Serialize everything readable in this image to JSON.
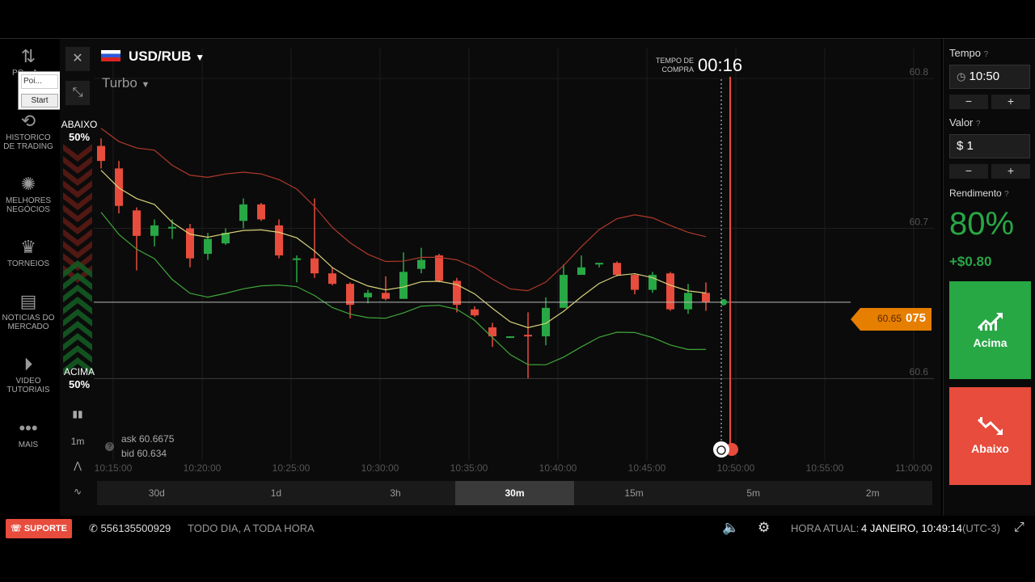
{
  "nav": {
    "items": [
      {
        "label": "PO... A...",
        "icon": "swap-arrows-icon"
      },
      {
        "label": "HISTORICO DE TRADING",
        "icon": "history-icon"
      },
      {
        "label": "MELHORES NEGÓCIOS",
        "icon": "best-deals-icon"
      },
      {
        "label": "TORNEIOS",
        "icon": "trophy-icon"
      },
      {
        "label": "NOTICIAS DO MERCADO",
        "icon": "news-icon"
      },
      {
        "label": "VIDEO TUTORIAIS",
        "icon": "play-icon"
      },
      {
        "label": "MAIS",
        "icon": "more-dots-icon"
      }
    ]
  },
  "popup": {
    "input_value": "Poi...",
    "button_label": "Start"
  },
  "asset": {
    "name": "USD/RUB",
    "mode": "Turbo"
  },
  "timer": {
    "label": "TEMPO DE COMPRA",
    "value": "00:16"
  },
  "sentiment": {
    "down_label": "ABAIXO",
    "down_pct": "50%",
    "up_label": "ACIMA",
    "up_pct": "50%"
  },
  "quote": {
    "ask": "ask 60.6675",
    "bid": "bid 60.634",
    "timeframe": "1m"
  },
  "current_price": {
    "prefix": "60.65",
    "suffix": "075"
  },
  "chart_data": {
    "type": "candlestick",
    "y_ticks": [
      "60.8",
      "60.7",
      "60.6"
    ],
    "x_ticks": [
      "10:15:00",
      "10:20:00",
      "10:25:00",
      "10:30:00",
      "10:35:00",
      "10:40:00",
      "10:45:00",
      "10:50:00",
      "10:55:00",
      "11:00:00"
    ],
    "ylim": [
      60.545,
      60.82
    ],
    "candles": [
      {
        "o": 60.755,
        "c": 60.745,
        "h": 60.76,
        "l": 60.74
      },
      {
        "o": 60.74,
        "c": 60.715,
        "h": 60.745,
        "l": 60.71
      },
      {
        "o": 60.712,
        "c": 60.695,
        "h": 60.714,
        "l": 60.672
      },
      {
        "o": 60.695,
        "c": 60.702,
        "h": 60.706,
        "l": 60.688
      },
      {
        "o": 60.7,
        "c": 60.701,
        "h": 60.706,
        "l": 60.693
      },
      {
        "o": 60.7,
        "c": 60.68,
        "h": 60.703,
        "l": 60.674
      },
      {
        "o": 60.683,
        "c": 60.693,
        "h": 60.697,
        "l": 60.679
      },
      {
        "o": 60.69,
        "c": 60.697,
        "h": 60.7,
        "l": 60.689
      },
      {
        "o": 60.705,
        "c": 60.716,
        "h": 60.72,
        "l": 60.7
      },
      {
        "o": 60.716,
        "c": 60.706,
        "h": 60.717,
        "l": 60.705
      },
      {
        "o": 60.702,
        "c": 60.682,
        "h": 60.706,
        "l": 60.68
      },
      {
        "o": 60.68,
        "c": 60.68,
        "h": 60.682,
        "l": 60.664
      },
      {
        "o": 60.68,
        "c": 60.67,
        "h": 60.72,
        "l": 60.667
      },
      {
        "o": 60.67,
        "c": 60.663,
        "h": 60.674,
        "l": 60.662
      },
      {
        "o": 60.663,
        "c": 60.649,
        "h": 60.664,
        "l": 60.64
      },
      {
        "o": 60.654,
        "c": 60.657,
        "h": 60.659,
        "l": 60.65
      },
      {
        "o": 60.657,
        "c": 60.653,
        "h": 60.668,
        "l": 60.652
      },
      {
        "o": 60.653,
        "c": 60.671,
        "h": 60.684,
        "l": 60.653
      },
      {
        "o": 60.673,
        "c": 60.679,
        "h": 60.687,
        "l": 60.67
      },
      {
        "o": 60.682,
        "c": 60.665,
        "h": 60.683,
        "l": 60.664
      },
      {
        "o": 60.665,
        "c": 60.649,
        "h": 60.667,
        "l": 60.644
      },
      {
        "o": 60.646,
        "c": 60.642,
        "h": 60.648,
        "l": 60.641
      },
      {
        "o": 60.634,
        "c": 60.628,
        "h": 60.637,
        "l": 60.621
      },
      {
        "o": 60.628,
        "c": 60.628,
        "h": 60.628,
        "l": 60.627
      },
      {
        "o": 60.629,
        "c": 60.628,
        "h": 60.644,
        "l": 60.6
      },
      {
        "o": 60.628,
        "c": 60.647,
        "h": 60.654,
        "l": 60.622
      },
      {
        "o": 60.647,
        "c": 60.669,
        "h": 60.676,
        "l": 60.647
      },
      {
        "o": 60.669,
        "c": 60.674,
        "h": 60.682,
        "l": 60.669
      },
      {
        "o": 60.676,
        "c": 60.677,
        "h": 60.677,
        "l": 60.674
      },
      {
        "o": 60.677,
        "c": 60.669,
        "h": 60.678,
        "l": 60.668
      },
      {
        "o": 60.669,
        "c": 60.659,
        "h": 60.67,
        "l": 60.656
      },
      {
        "o": 60.659,
        "c": 60.669,
        "h": 60.671,
        "l": 60.657
      },
      {
        "o": 60.67,
        "c": 60.646,
        "h": 60.671,
        "l": 60.645
      },
      {
        "o": 60.646,
        "c": 60.657,
        "h": 60.663,
        "l": 60.643
      },
      {
        "o": 60.657,
        "c": 60.651,
        "h": 60.664,
        "l": 60.645
      }
    ],
    "up_color": "#28a745",
    "down_color": "#e74c3c",
    "band_colors": {
      "upper": "#b0392b",
      "middle": "#d8d27a",
      "lower": "#3fa63a"
    }
  },
  "ranges": {
    "items": [
      "30d",
      "1d",
      "3h",
      "30m",
      "15m",
      "5m",
      "2m"
    ],
    "active": "30m"
  },
  "trade": {
    "time_label": "Tempo",
    "time_value": "10:50",
    "value_label": "Valor",
    "value_value": "$ 1",
    "yield_label": "Rendimento",
    "yield_pct": "80%",
    "yield_value": "+$0.80",
    "up_button": "Acima",
    "down_button": "Abaixo",
    "minus": "−",
    "plus": "+",
    "help_icon": "?"
  },
  "footer": {
    "support": "SUPORTE",
    "phone": "556135500929",
    "hours": "TODO DIA, A TODA HORA",
    "clock_label": "HORA ATUAL:",
    "clock_value": "4 JANEIRO, 10:49:14",
    "timezone": "(UTC-3)"
  }
}
